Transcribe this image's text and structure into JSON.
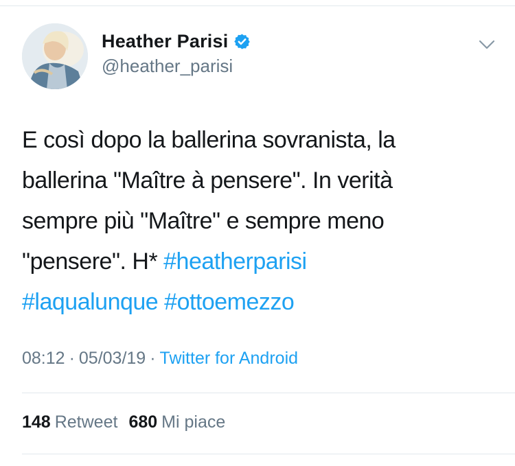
{
  "user": {
    "display_name": "Heather Parisi",
    "handle": "@heather_parisi",
    "verified": true
  },
  "tweet": {
    "lines": [
      [
        {
          "text": "E così dopo la ballerina sovranista, la",
          "type": "text"
        }
      ],
      [
        {
          "text": "ballerina \"Maître à pensere\". In verità",
          "type": "text"
        }
      ],
      [
        {
          "text": "sempre più \"Maître\" e sempre meno",
          "type": "text"
        }
      ],
      [
        {
          "text": "\"pensere\". H* ",
          "type": "text"
        },
        {
          "text": "#heatherparisi",
          "type": "hashtag"
        }
      ],
      [
        {
          "text": "#laqualunque",
          "type": "hashtag"
        },
        {
          "text": " ",
          "type": "text"
        },
        {
          "text": "#ottoemezzo",
          "type": "hashtag"
        }
      ]
    ]
  },
  "meta": {
    "time": "08:12",
    "separator": "·",
    "date": "05/03/19",
    "client": "Twitter for Android"
  },
  "stats": {
    "retweets_count": "148",
    "retweets_label": "Retweet",
    "likes_count": "680",
    "likes_label": "Mi piace"
  },
  "colors": {
    "link": "#1da1f2",
    "secondary_text": "#657786",
    "primary_text": "#14171a",
    "divider": "#e1e8ed"
  },
  "icons": {
    "verified": "verified-badge-icon",
    "menu": "chevron-down-icon"
  }
}
